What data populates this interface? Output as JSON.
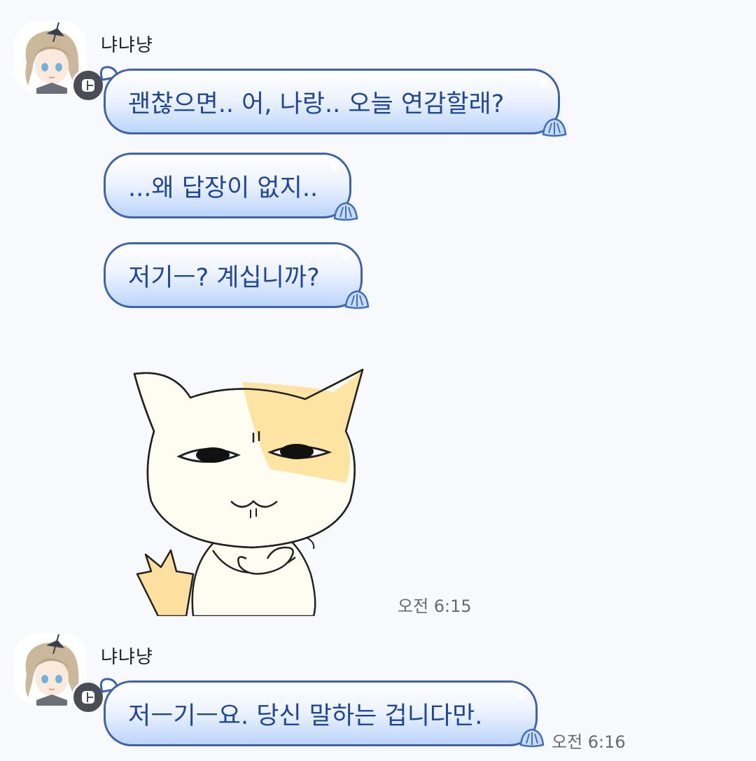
{
  "colors": {
    "background": "#f8f9fc",
    "bubble_border": "#3f63a8",
    "bubble_text": "#20469a",
    "bubble_gradient_bottom": "#bcd5fb"
  },
  "group1": {
    "sender": "냐냐냥",
    "avatar_icon": "profile-avatar-icon",
    "badge_icon": "profile-badge-icon",
    "messages": [
      {
        "text": "괜찮으면.. 어, 나랑.. 오늘 연감할래?"
      },
      {
        "text": "...왜 답장이 없지.."
      },
      {
        "text": "저기ㅡ? 계십니까?"
      }
    ],
    "sticker_icon": "cat-sticker-arms-crossed",
    "time": "오전 6:15"
  },
  "group2": {
    "sender": "냐냐냥",
    "avatar_icon": "profile-avatar-icon",
    "badge_icon": "profile-badge-icon",
    "messages": [
      {
        "text": "저ㅡ기ㅡ요. 당신 말하는 겁니다만."
      }
    ],
    "time": "오전 6:16"
  }
}
